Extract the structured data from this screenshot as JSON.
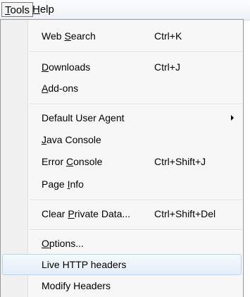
{
  "menubar": {
    "tools": {
      "pre": "",
      "key": "T",
      "post": "ools"
    },
    "help": {
      "pre": "",
      "key": "H",
      "post": "elp"
    }
  },
  "menu": {
    "web_search": {
      "pre": "Web ",
      "key": "S",
      "post": "earch",
      "shortcut": "Ctrl+K"
    },
    "downloads": {
      "pre": "",
      "key": "D",
      "post": "ownloads",
      "shortcut": "Ctrl+J"
    },
    "addons": {
      "pre": "",
      "key": "A",
      "post": "dd-ons"
    },
    "default_user_agent": {
      "label": "Default User Agent"
    },
    "java_console": {
      "pre": "",
      "key": "J",
      "post": "ava Console"
    },
    "error_console": {
      "pre": "Error ",
      "key": "C",
      "post": "onsole",
      "shortcut": "Ctrl+Shift+J"
    },
    "page_info": {
      "pre": "Page ",
      "key": "I",
      "post": "nfo"
    },
    "clear_private_data": {
      "pre": "Clear ",
      "key": "P",
      "post": "rivate Data...",
      "shortcut": "Ctrl+Shift+Del"
    },
    "options": {
      "pre": "",
      "key": "O",
      "post": "ptions..."
    },
    "live_http_headers": {
      "label": "Live HTTP headers"
    },
    "modify_headers": {
      "label": "Modify Headers"
    }
  },
  "icons": {
    "submenu_arrow": "submenu-arrow-icon"
  },
  "colors": {
    "menu_bg": "#f7f7f7",
    "gutter_bg": "#f0f0f0",
    "highlight_border": "#b9d4ee",
    "highlight_bg": "#e3eef9"
  }
}
